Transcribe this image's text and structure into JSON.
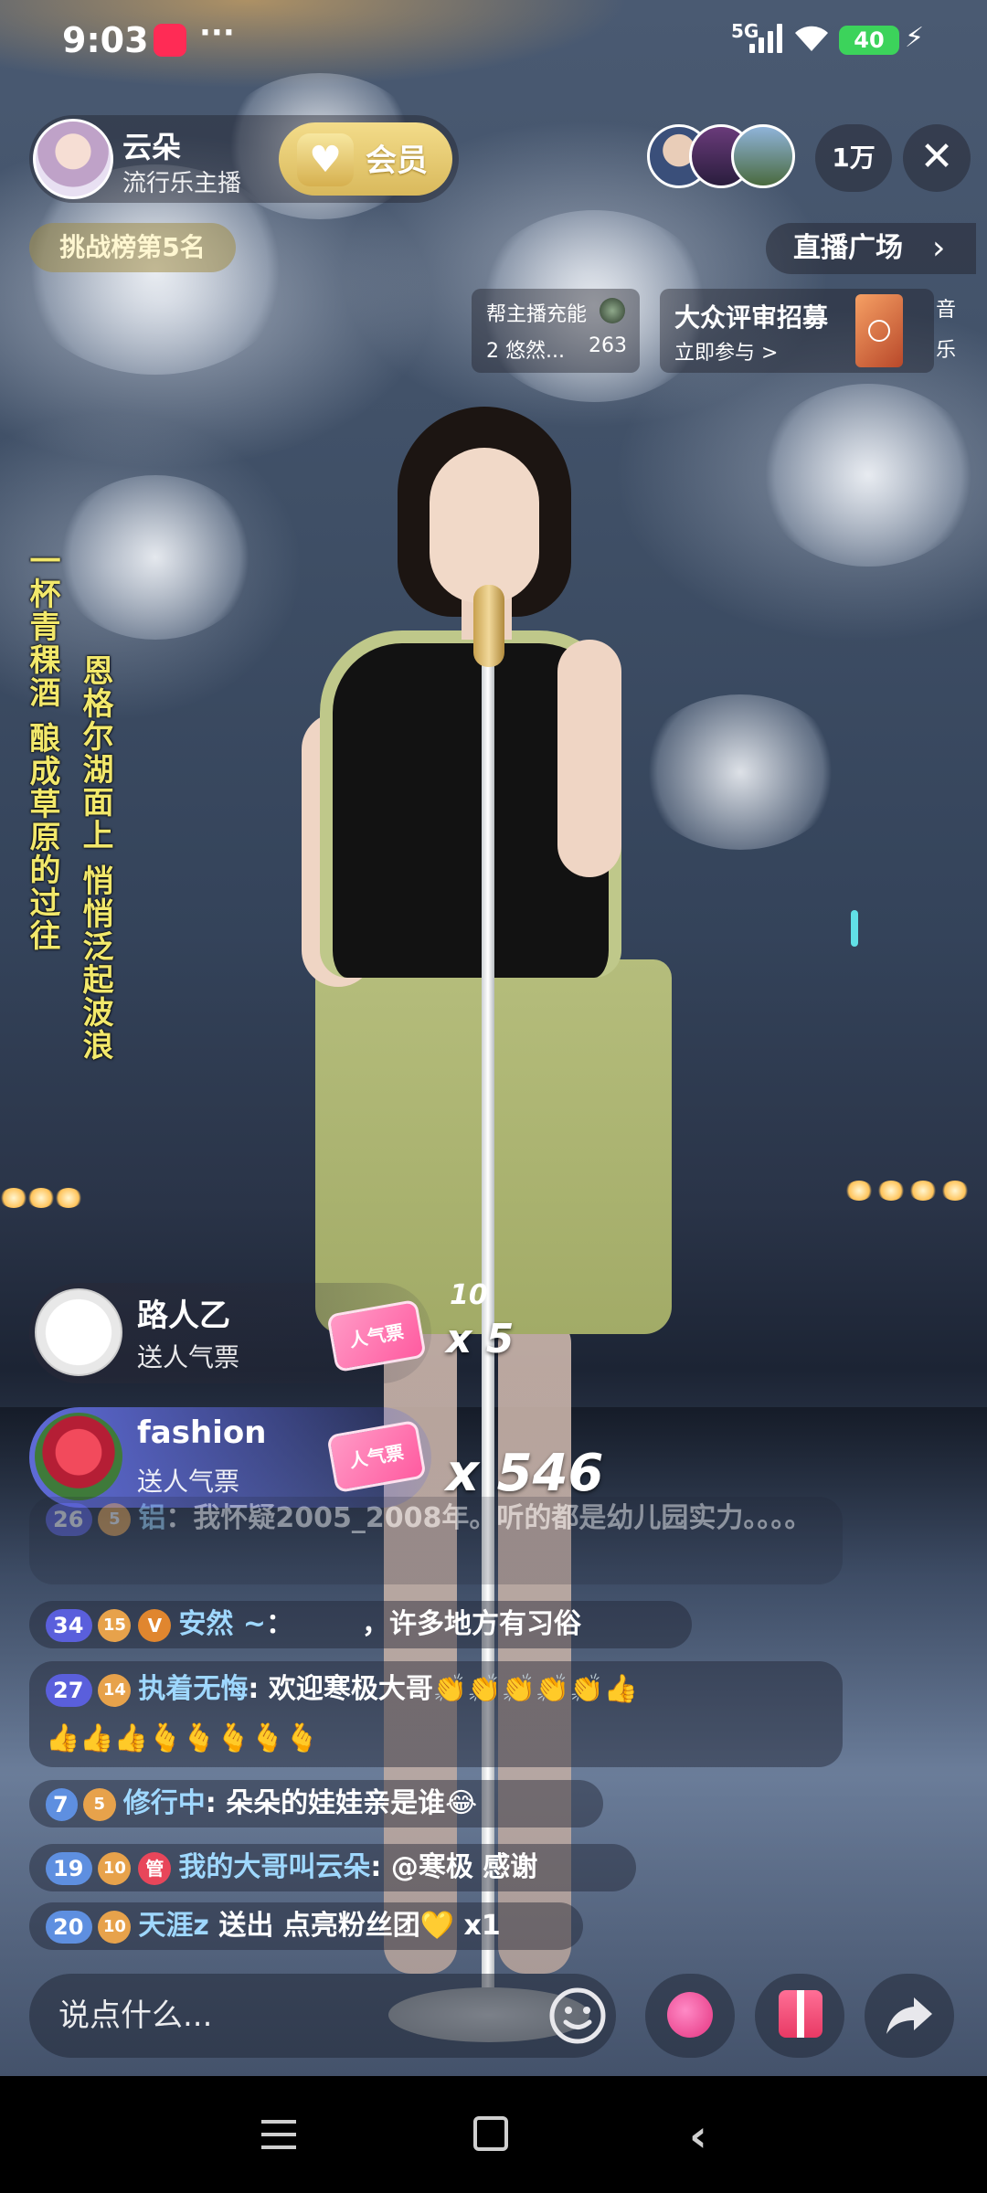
{
  "status_bar": {
    "time": "9:03",
    "more": "···",
    "network": "5G",
    "battery": "40",
    "charging_icon": "bolt-icon"
  },
  "host": {
    "name": "云朵",
    "role": "流行乐主播",
    "vip_label": "会员",
    "viewer_count": "1万",
    "close": "✕"
  },
  "chips": {
    "rank": "挑战榜第5名",
    "plaza": "直播广场",
    "plaza_chevron": "›"
  },
  "charge_card": {
    "title": "帮主播充能",
    "subtitle": "2 悠然...",
    "count": "263"
  },
  "recruit_card": {
    "title": "大众评审招募",
    "action": "立即参与 >",
    "side_label_1": "音",
    "side_label_2": "乐"
  },
  "lyrics": {
    "line1": "一杯青稞酒 酿成草原的过往",
    "line2": "恩格尔湖面上 悄悄泛起波浪"
  },
  "gifts": [
    {
      "user": "路人乙",
      "action": "送人气票",
      "ticket": "人气票",
      "count": "x 5",
      "small": "10"
    },
    {
      "user": "fashion",
      "action": "送人气票",
      "ticket": "人气票",
      "count": "x 546"
    }
  ],
  "chat": [
    {
      "level": "26",
      "fan": "5",
      "user": "铝",
      "text": "：我怀疑2005_2008年。听的都是幼儿园实力。。。。"
    },
    {
      "level": "34",
      "fan": "15",
      "badge": "V",
      "user": "安然 ~",
      "text": "：　　　，许多地方有习俗"
    },
    {
      "level": "27",
      "fan": "14",
      "user": "执着无悔",
      "text": ": 欢迎寒极大哥👏👏👏👏👏👍",
      "line2": "👍👍👍🫰🫰🫰🫰🫰"
    },
    {
      "level": "7",
      "fan": "5",
      "user": "修行中",
      "text": ": 朵朵的娃娃亲是谁😂"
    },
    {
      "level": "19",
      "fan": "10",
      "badge": "管",
      "user": "我的大哥叫云朵",
      "text": ": @寒极 感谢"
    },
    {
      "level": "20",
      "fan": "10",
      "user": "天涯z",
      "text": " 送出 点亮粉丝团💛 x1"
    }
  ],
  "input": {
    "placeholder": "说点什么..."
  },
  "icons": {
    "emoji": "emoji-icon",
    "like": "heart-icon",
    "gift": "gift-icon",
    "share": "share-icon"
  },
  "colors": {
    "lyric": "#f2e86b",
    "username": "#9fd8ff",
    "vip_gold": "#d9b95c",
    "battery": "#3cd35b"
  }
}
